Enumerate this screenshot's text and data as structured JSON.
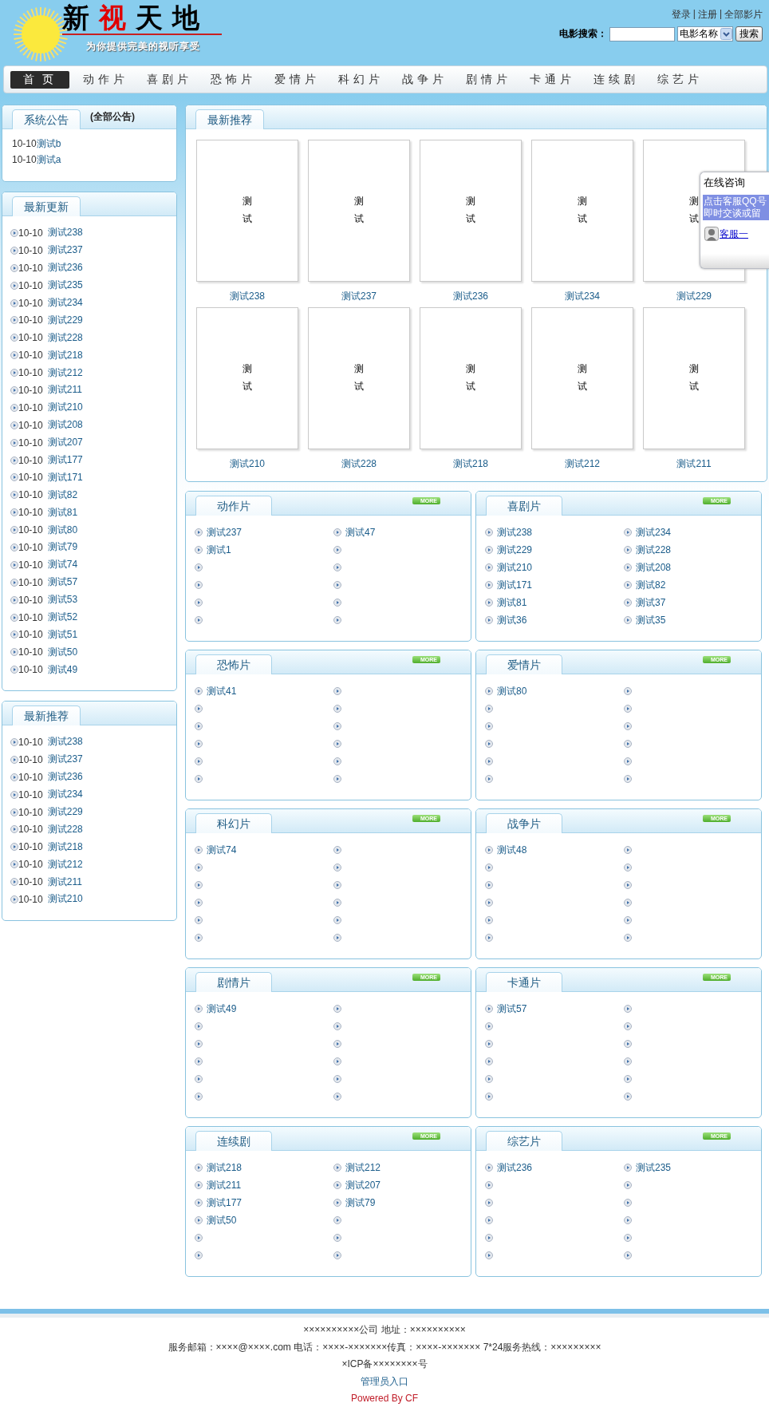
{
  "header": {
    "logo": {
      "title_chars": [
        {
          "char": "新",
          "color": "#000000"
        },
        {
          "char": "视",
          "color": "#e00000"
        },
        {
          "char": "天",
          "color": "#000000"
        },
        {
          "char": "地",
          "color": "#000000"
        }
      ],
      "subtitle": "为你提供完美的视听享受"
    },
    "top_links": [
      "登录",
      "注册",
      "全部影片"
    ],
    "link_separator": "|",
    "search": {
      "label": "电影搜索：",
      "select": "电影名称",
      "button": "搜索"
    }
  },
  "nav": [
    {
      "label": "首页",
      "selected": true
    },
    {
      "label": "动作片",
      "selected": false
    },
    {
      "label": "喜剧片",
      "selected": false
    },
    {
      "label": "恐怖片",
      "selected": false
    },
    {
      "label": "爱情片",
      "selected": false
    },
    {
      "label": "科幻片",
      "selected": false
    },
    {
      "label": "战争片",
      "selected": false
    },
    {
      "label": "剧情片",
      "selected": false
    },
    {
      "label": "卡通片",
      "selected": false
    },
    {
      "label": "连续剧",
      "selected": false
    },
    {
      "label": "综艺片",
      "selected": false
    }
  ],
  "sidebar": [
    {
      "kind": "notice",
      "title": "系统公告",
      "extra": "(全部公告)",
      "items": [
        {
          "date": "10-10",
          "title": "测试b"
        },
        {
          "date": "10-10",
          "title": "测试a"
        }
      ]
    },
    {
      "kind": "list",
      "title": "最新更新",
      "items": [
        {
          "date": "10-10",
          "title": "测试238"
        },
        {
          "date": "10-10",
          "title": "测试237"
        },
        {
          "date": "10-10",
          "title": "测试236"
        },
        {
          "date": "10-10",
          "title": "测试235"
        },
        {
          "date": "10-10",
          "title": "测试234"
        },
        {
          "date": "10-10",
          "title": "测试229"
        },
        {
          "date": "10-10",
          "title": "测试228"
        },
        {
          "date": "10-10",
          "title": "测试218"
        },
        {
          "date": "10-10",
          "title": "测试212"
        },
        {
          "date": "10-10",
          "title": "测试211"
        },
        {
          "date": "10-10",
          "title": "测试210"
        },
        {
          "date": "10-10",
          "title": "测试208"
        },
        {
          "date": "10-10",
          "title": "测试207"
        },
        {
          "date": "10-10",
          "title": "测试177"
        },
        {
          "date": "10-10",
          "title": "测试171"
        },
        {
          "date": "10-10",
          "title": "测试82"
        },
        {
          "date": "10-10",
          "title": "测试81"
        },
        {
          "date": "10-10",
          "title": "测试80"
        },
        {
          "date": "10-10",
          "title": "测试79"
        },
        {
          "date": "10-10",
          "title": "测试74"
        },
        {
          "date": "10-10",
          "title": "测试57"
        },
        {
          "date": "10-10",
          "title": "测试53"
        },
        {
          "date": "10-10",
          "title": "测试52"
        },
        {
          "date": "10-10",
          "title": "测试51"
        },
        {
          "date": "10-10",
          "title": "测试50"
        },
        {
          "date": "10-10",
          "title": "测试49"
        }
      ]
    },
    {
      "kind": "list",
      "title": "最新推荐",
      "items": [
        {
          "date": "10-10",
          "title": "测试238"
        },
        {
          "date": "10-10",
          "title": "测试237"
        },
        {
          "date": "10-10",
          "title": "测试236"
        },
        {
          "date": "10-10",
          "title": "测试234"
        },
        {
          "date": "10-10",
          "title": "测试229"
        },
        {
          "date": "10-10",
          "title": "测试228"
        },
        {
          "date": "10-10",
          "title": "测试218"
        },
        {
          "date": "10-10",
          "title": "测试212"
        },
        {
          "date": "10-10",
          "title": "测试211"
        },
        {
          "date": "10-10",
          "title": "测试210"
        }
      ]
    }
  ],
  "recommended": {
    "title": "最新推荐",
    "movies": [
      {
        "poster_text": "测试",
        "title": "测试238"
      },
      {
        "poster_text": "测试",
        "title": "测试237"
      },
      {
        "poster_text": "测试",
        "title": "测试236"
      },
      {
        "poster_text": "测试",
        "title": "测试234"
      },
      {
        "poster_text": "测试",
        "title": "测试229"
      },
      {
        "poster_text": "测试",
        "title": "测试210"
      },
      {
        "poster_text": "测试",
        "title": "测试228"
      },
      {
        "poster_text": "测试",
        "title": "测试218"
      },
      {
        "poster_text": "测试",
        "title": "测试212"
      },
      {
        "poster_text": "测试",
        "title": "测试211"
      }
    ]
  },
  "categories": [
    {
      "title": "动作片",
      "more": "MORE",
      "items": [
        "测试237",
        "测试47",
        "测试1"
      ]
    },
    {
      "title": "喜剧片",
      "more": "MORE",
      "items": [
        "测试238",
        "测试234",
        "测试229",
        "测试228",
        "测试210",
        "测试208",
        "测试171",
        "测试82",
        "测试81",
        "测试37",
        "测试36",
        "测试35"
      ]
    },
    {
      "title": "恐怖片",
      "more": "MORE",
      "items": [
        "测试41"
      ]
    },
    {
      "title": "爱情片",
      "more": "MORE",
      "items": [
        "测试80"
      ]
    },
    {
      "title": "科幻片",
      "more": "MORE",
      "items": [
        "测试74"
      ]
    },
    {
      "title": "战争片",
      "more": "MORE",
      "items": [
        "测试48"
      ]
    },
    {
      "title": "剧情片",
      "more": "MORE",
      "items": [
        "测试49"
      ]
    },
    {
      "title": "卡通片",
      "more": "MORE",
      "items": [
        "测试57"
      ]
    },
    {
      "title": "连续剧",
      "more": "MORE",
      "items": [
        "测试218",
        "测试212",
        "测试211",
        "测试207",
        "测试177",
        "测试79",
        "测试50"
      ]
    },
    {
      "title": "综艺片",
      "more": "MORE",
      "items": [
        "测试236",
        "测试235"
      ]
    }
  ],
  "chat_widget": {
    "title": "在线咨询",
    "message_lines": [
      "点击客服QQ号",
      "即时交谈或留"
    ],
    "agent": "客服一"
  },
  "footer": {
    "lines": [
      "××××××××××公司  地址：××××××××××",
      "服务邮箱：××××@××××.com 电话：××××-×××××××传真：××××-××××××× 7*24服务热线：×××××××××",
      "×ICP备××××××××号"
    ],
    "admin_link": "管理员入口",
    "powered": "Powered By CF"
  }
}
